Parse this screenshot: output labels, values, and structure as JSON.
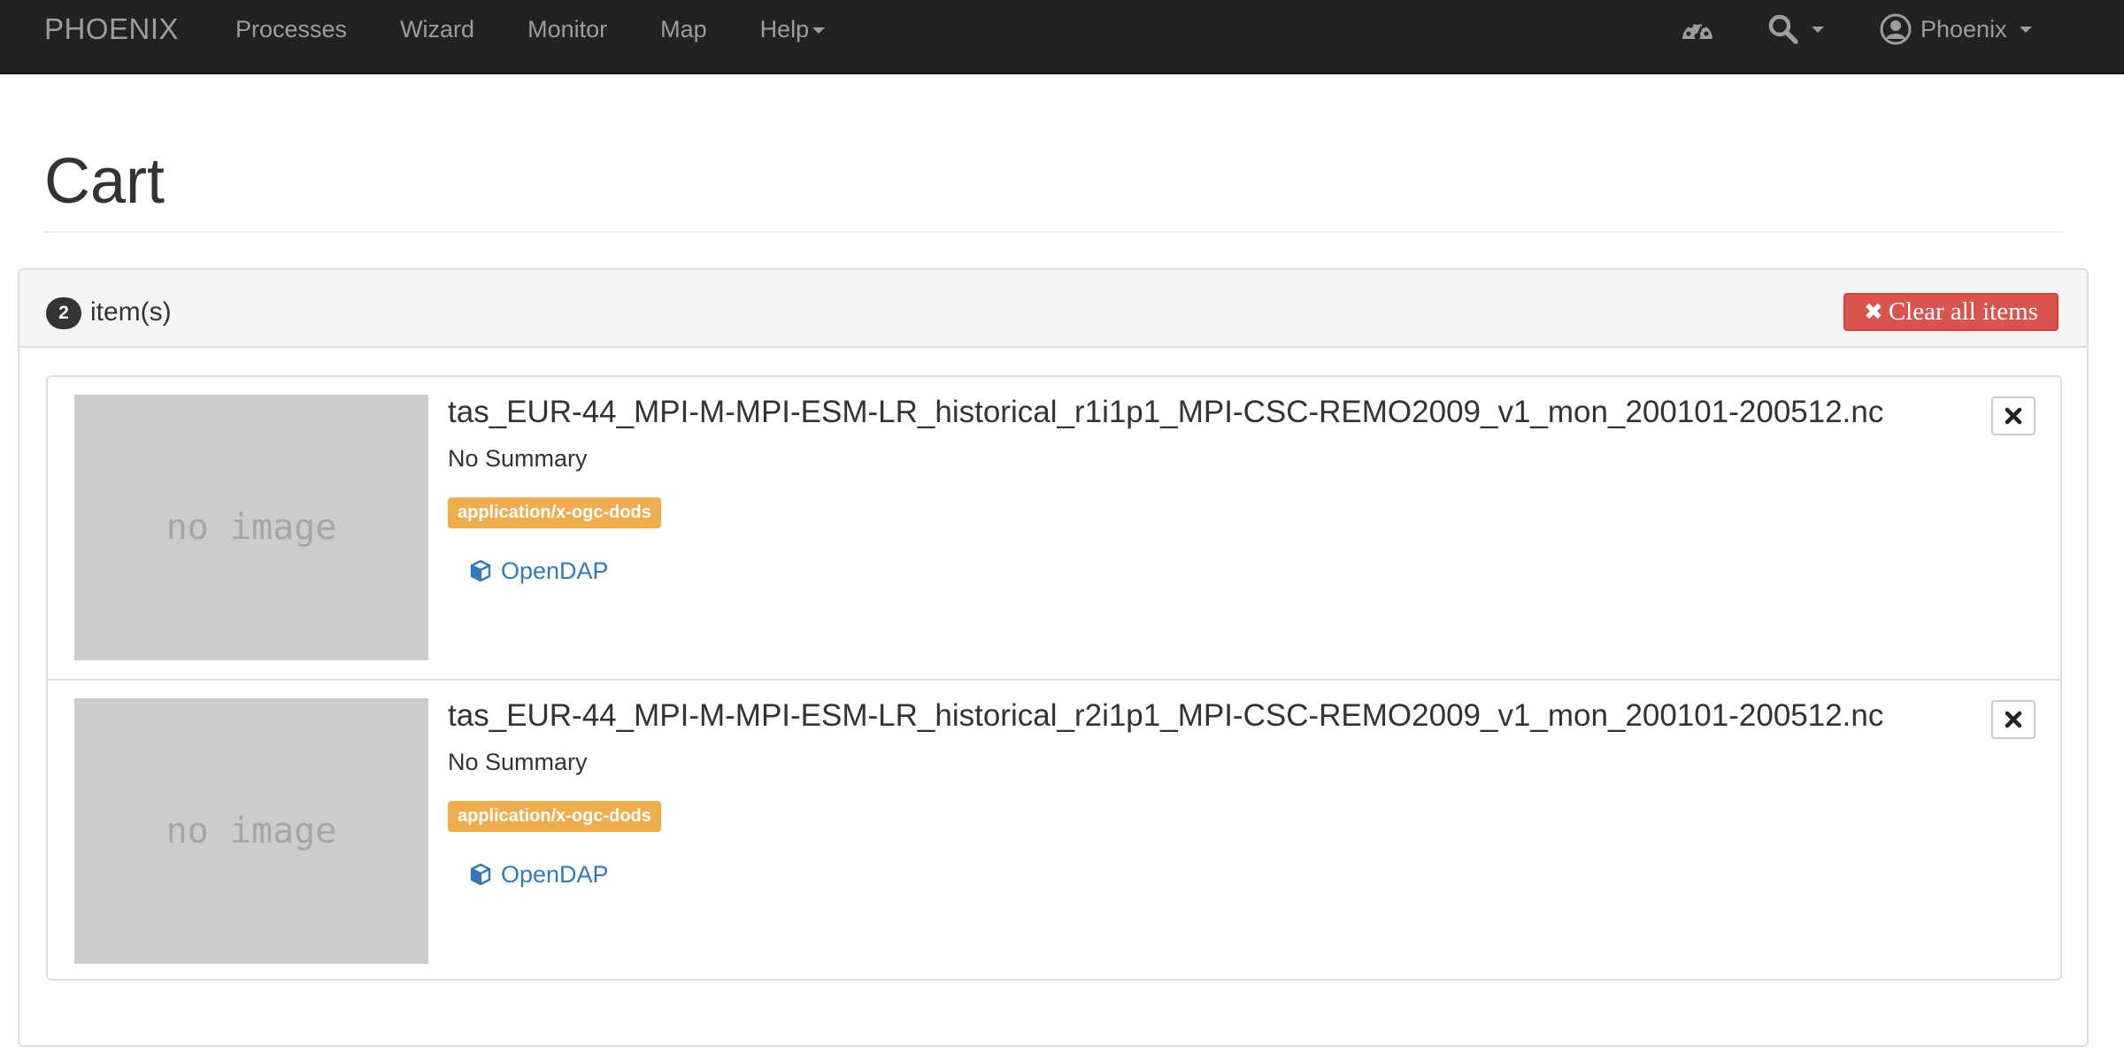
{
  "navbar": {
    "brand": "PHOENIX",
    "links": [
      {
        "label": "Processes"
      },
      {
        "label": "Wizard"
      },
      {
        "label": "Monitor"
      },
      {
        "label": "Map"
      },
      {
        "label": "Help"
      }
    ],
    "icons": {
      "dashboard": "dashboard-icon",
      "search": "search-icon",
      "user": "user-circle-icon"
    },
    "user_label": "Phoenix"
  },
  "page": {
    "title": "Cart"
  },
  "cart": {
    "count": "2",
    "count_label": "item(s)",
    "clear_label": "Clear all items",
    "items": [
      {
        "thumbnail_text": "no image",
        "title": "tas_EUR-44_MPI-M-MPI-ESM-LR_historical_r1i1p1_MPI-CSC-REMO2009_v1_mon_200101-200512.nc",
        "summary": "No Summary",
        "format": "application/x-ogc-dods",
        "link_label": "OpenDAP"
      },
      {
        "thumbnail_text": "no image",
        "title": "tas_EUR-44_MPI-M-MPI-ESM-LR_historical_r2i1p1_MPI-CSC-REMO2009_v1_mon_200101-200512.nc",
        "summary": "No Summary",
        "format": "application/x-ogc-dods",
        "link_label": "OpenDAP"
      }
    ]
  },
  "colors": {
    "navbar_bg": "#222222",
    "nav_text": "#9d9d9d",
    "danger": "#d9534f",
    "warning_label": "#f0ad4e",
    "link": "#337ab7"
  }
}
